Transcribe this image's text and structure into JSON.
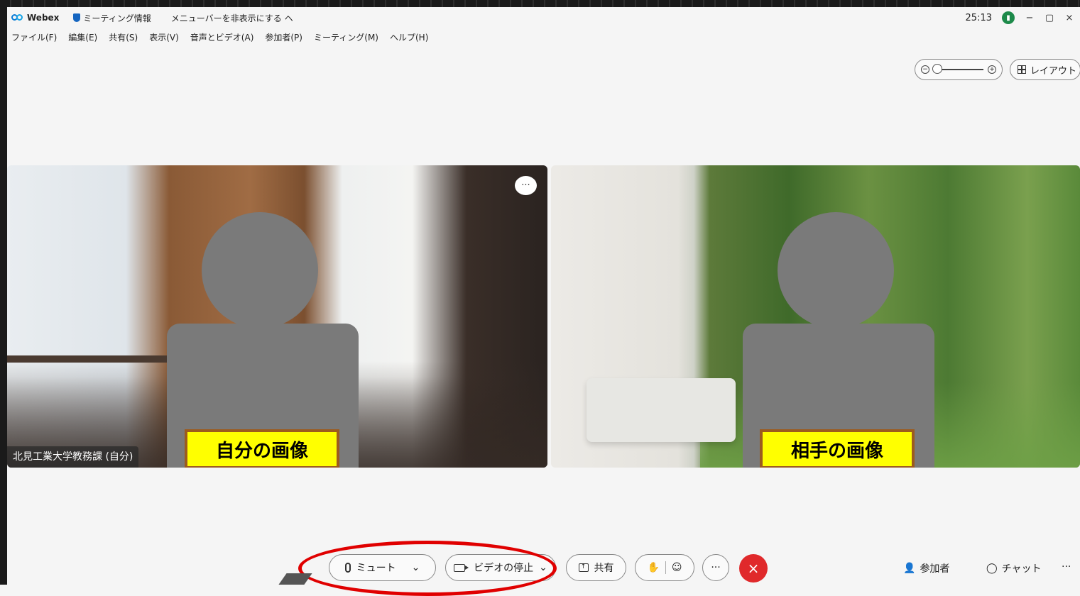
{
  "titlebar": {
    "app_name": "Webex",
    "meeting_info": "ミーティング情報",
    "hide_menu": "メニューバーを非表示にする",
    "hide_menu_chevron": "ヘ",
    "timer": "25:13",
    "min": "−",
    "restore": "▢",
    "close": "×"
  },
  "menu": [
    "ファイル(F)",
    "編集(E)",
    "共有(S)",
    "表示(V)",
    "音声とビデオ(A)",
    "参加者(P)",
    "ミーティング(M)",
    "ヘルプ(H)"
  ],
  "toolbar": {
    "zoom_out": "−",
    "zoom_in": "+",
    "zoom_level": 0.0,
    "layout_label": "レイアウト"
  },
  "tiles": {
    "self_name": "北見工業大学教務課 (自分)",
    "self_callout": "自分の画像",
    "peer_callout": "相手の画像",
    "more": "···"
  },
  "controls": {
    "mute": "ミュート",
    "video_stop": "ビデオの停止",
    "share": "共有",
    "raise_hand": "✋",
    "reactions": "☺",
    "more": "···",
    "end": "×",
    "dropdown": "⌄",
    "participants": "参加者",
    "chat": "チャット",
    "right_more": "···"
  },
  "colors": {
    "end_call": "#e0292b",
    "annotation_circle": "#e00000",
    "callout_fill": "#ffff00",
    "callout_border": "#9c5b1e",
    "network_ok": "#1d8a4a"
  }
}
